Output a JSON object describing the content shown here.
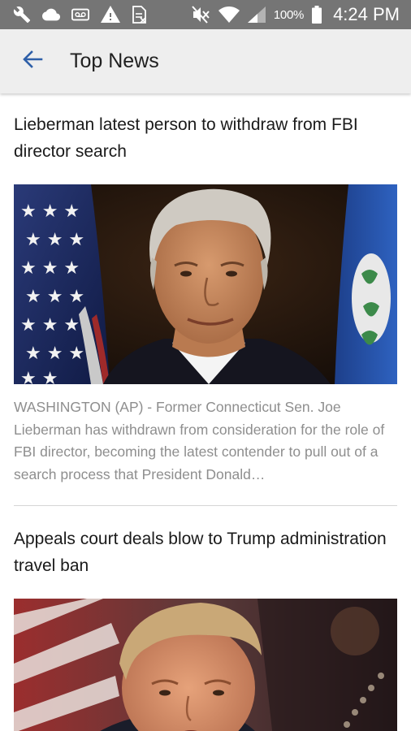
{
  "status_bar": {
    "battery_text": "100%",
    "time": "4:24 PM",
    "icons": [
      "wrench-icon",
      "cloud-icon",
      "voicemail-icon",
      "warning-icon",
      "document-icon",
      "mute-icon",
      "wifi-icon",
      "signal-icon",
      "battery-icon"
    ]
  },
  "app_bar": {
    "title": "Top News",
    "back_icon": "back-arrow-icon"
  },
  "articles": [
    {
      "headline": "Lieberman latest person to withdraw from FBI director search",
      "summary": "WASHINGTON (AP) - Former Connecticut Sen. Joe Lieberman has withdrawn from consideration for the role of FBI director, becoming the latest contender to pull out of a search process that President Donald…"
    },
    {
      "headline": "Appeals court deals blow to Trump administration travel ban"
    }
  ],
  "colors": {
    "status_bar": "#757575",
    "app_bar": "#eeeeee",
    "accent": "#2e5fa8",
    "summary_text": "#8e8e8e"
  }
}
